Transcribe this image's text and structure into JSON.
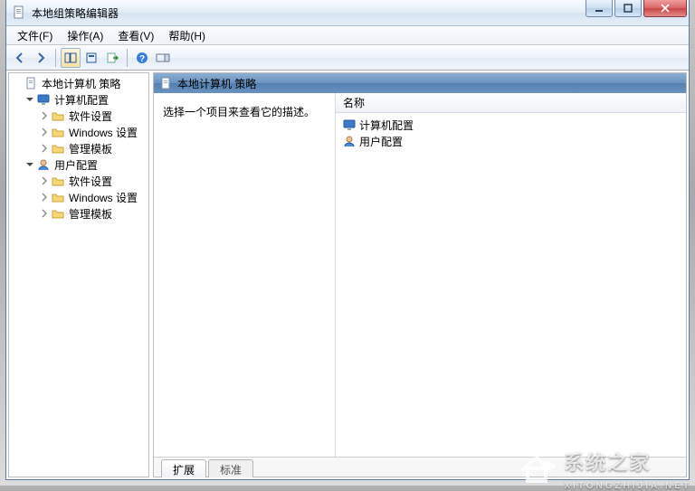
{
  "window": {
    "title": "本地组策略编辑器"
  },
  "menu": {
    "file": "文件(F)",
    "action": "操作(A)",
    "view": "查看(V)",
    "help": "帮助(H)"
  },
  "toolbar_icons": {
    "back": "back-icon",
    "forward": "forward-icon",
    "up": "up-icon",
    "show_hide_tree": "show-hide-tree-icon",
    "properties": "properties-icon",
    "export": "export-icon",
    "help": "help-icon",
    "toggle": "toggle-icon"
  },
  "tree": {
    "root": {
      "label": "本地计算机 策略"
    },
    "computer": {
      "label": "计算机配置",
      "children": [
        {
          "label": "软件设置"
        },
        {
          "label": "Windows 设置"
        },
        {
          "label": "管理模板"
        }
      ]
    },
    "user": {
      "label": "用户配置",
      "children": [
        {
          "label": "软件设置"
        },
        {
          "label": "Windows 设置"
        },
        {
          "label": "管理模板"
        }
      ]
    }
  },
  "content": {
    "header_title": "本地计算机 策略",
    "description_prompt": "选择一个项目来查看它的描述。",
    "list_header": "名称",
    "items": [
      {
        "label": "计算机配置"
      },
      {
        "label": "用户配置"
      }
    ]
  },
  "tabs": {
    "extended": "扩展",
    "standard": "标准"
  },
  "watermark": {
    "big": "系统之家",
    "small": "XITONGZHIJIA.NET"
  }
}
